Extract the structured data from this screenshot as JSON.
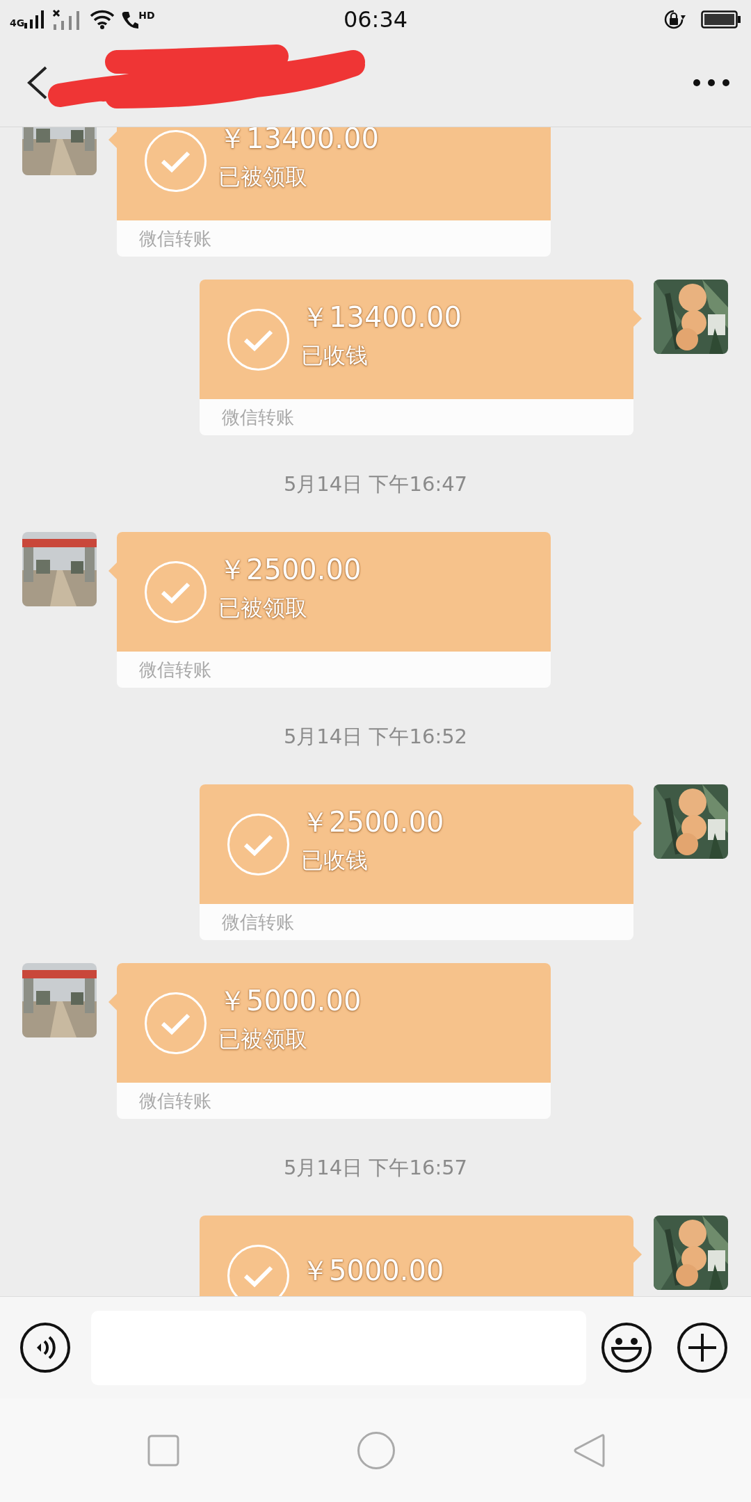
{
  "status_bar": {
    "network_label": "4G",
    "call_label": "HD",
    "time": "06:34"
  },
  "messages": [
    {
      "kind": "transfer",
      "from_me": false,
      "amount": "￥13400.00",
      "status": "已被领取",
      "footer": "微信转账"
    },
    {
      "kind": "transfer",
      "from_me": true,
      "amount": "￥13400.00",
      "status": "已收钱",
      "footer": "微信转账"
    },
    {
      "kind": "time",
      "text": "5月14日 下午16:47"
    },
    {
      "kind": "transfer",
      "from_me": false,
      "amount": "￥2500.00",
      "status": "已被领取",
      "footer": "微信转账"
    },
    {
      "kind": "time",
      "text": "5月14日 下午16:52"
    },
    {
      "kind": "transfer",
      "from_me": true,
      "amount": "￥2500.00",
      "status": "已收钱",
      "footer": "微信转账"
    },
    {
      "kind": "transfer",
      "from_me": false,
      "amount": "￥5000.00",
      "status": "已被领取",
      "footer": "微信转账"
    },
    {
      "kind": "time",
      "text": "5月14日 下午16:57"
    },
    {
      "kind": "transfer",
      "from_me": true,
      "amount": "￥5000.00"
    }
  ]
}
